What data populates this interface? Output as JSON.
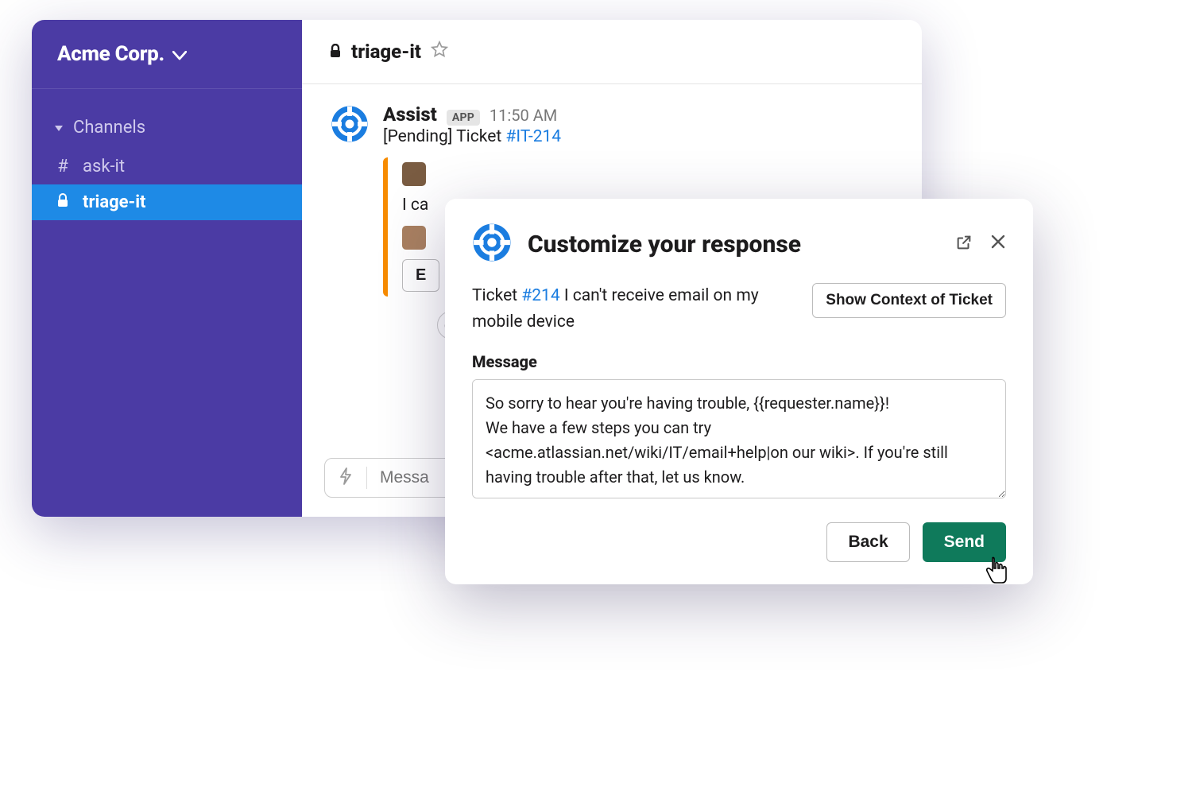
{
  "workspace": {
    "name": "Acme Corp."
  },
  "sidebar": {
    "section_label": "Channels",
    "items": [
      {
        "prefix": "#",
        "label": "ask-it",
        "active": false,
        "locked": false
      },
      {
        "prefix": "lock",
        "label": "triage-it",
        "active": true,
        "locked": true
      }
    ]
  },
  "channel_header": {
    "name": "triage-it",
    "locked": true
  },
  "message": {
    "author": "Assist",
    "badge": "APP",
    "time": "11:50 AM",
    "status_prefix": "[Pending] Ticket ",
    "ticket_ref": "#IT-214",
    "attachment_text": "I ca",
    "attachment_button": "E"
  },
  "composer": {
    "placeholder": "Messa"
  },
  "modal": {
    "title": "Customize your response",
    "ticket_label": "Ticket ",
    "ticket_ref": "#214",
    "ticket_text": " I can't receive email on my mobile device",
    "context_button": "Show Context of Ticket",
    "message_label": "Message",
    "message_value": "So sorry to hear you're having trouble, {{requester.name}}!\nWe have a few steps you can try\n<acme.atlassian.net/wiki/IT/email+help|on our wiki>. If you're still having trouble after that, let us know.",
    "back_label": "Back",
    "send_label": "Send"
  }
}
